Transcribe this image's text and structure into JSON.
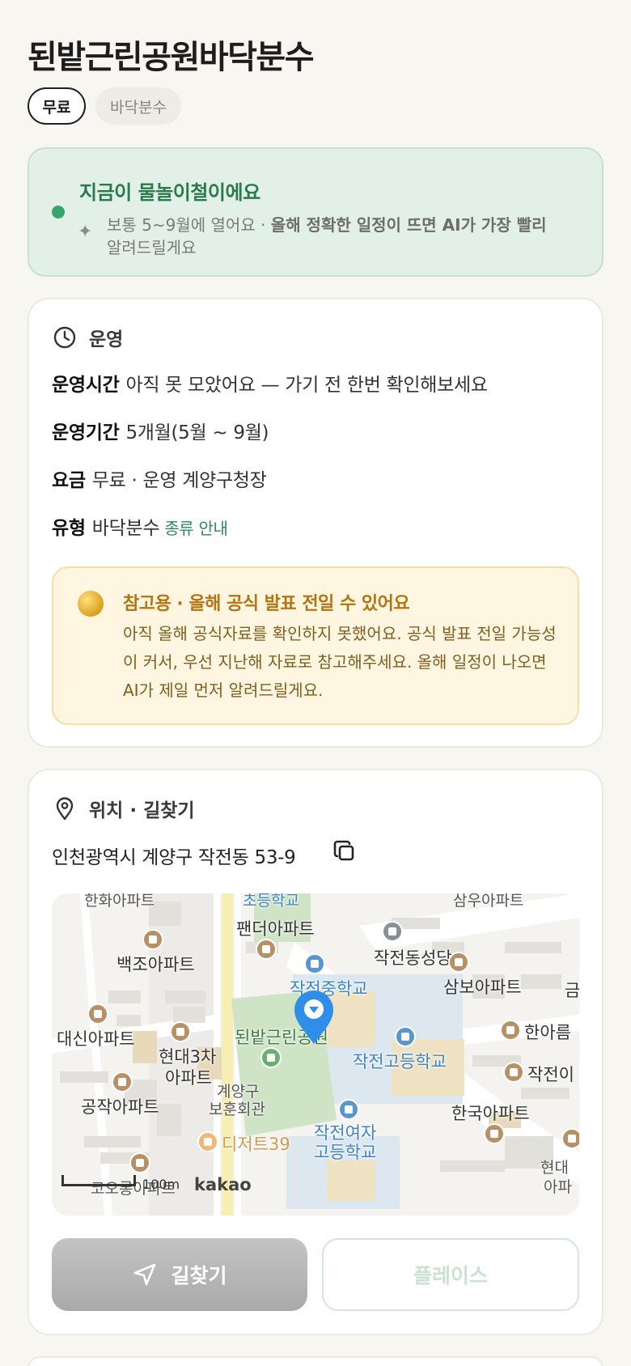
{
  "title": "된밭근린공원바닥분수",
  "chips": {
    "price": "무료",
    "type": "바닥분수"
  },
  "banner": {
    "headline": "지금이 물놀이철이에요",
    "sub_normal": "보통 5~9월에 열어요 · ",
    "sub_bold": "올해 정확한 일정이 뜨면 AI가 가장 빨리",
    "sub_tail": "알려드릴게요"
  },
  "operation": {
    "heading": "운영",
    "hours_key": "운영시간",
    "hours_val": "아직 못 모았어요 — 가기 전 한번 확인해보세요",
    "period_key": "운영기간",
    "period_val": "5개월(5월 ~ 9월)",
    "fee_key": "요금",
    "fee_val": "무료 · 운영 계양구청장",
    "type_key": "유형",
    "type_val": "바닥분수",
    "type_link": "종류 안내",
    "notice_title": "참고용 · 올해 공식 발표 전일 수 있어요",
    "notice_body": "아직 올해 공식자료를 확인하지 못했어요. 공식 발표 전일 가능성이 커서, 우선 지난해 자료로 참고해주세요. 올해 일정이 나오면 AI가 제일 먼저 알려드릴게요."
  },
  "location": {
    "heading": "위치 · 길찾기",
    "address": "인천광역시 계양구 작전동 53-9",
    "map": {
      "labels": {
        "top_left": "한화아파트",
        "top_school": "초등학교",
        "top_right": "삼우아파트",
        "pandeo": "팬더아파트",
        "baekjo": "백조아파트",
        "church": "작전동성당",
        "middle_school": "작전중학교",
        "sambo": "삼보아파트",
        "geum": "금",
        "daesin": "대신아파트",
        "hyundai3": "현대3차",
        "hyundai3b": "아파트",
        "park": "된밭근린공원",
        "hanareum": "한아름",
        "high_school": "작전고등학교",
        "jakjeon_right": "작전이",
        "gongjak": "공작아파트",
        "veterans1": "계양구",
        "veterans2": "보훈회관",
        "hanguk": "한국아파트",
        "girls_hs1": "작전여자",
        "girls_hs2": "고등학교",
        "cafe": "디저트39",
        "hyundai_r1": "현대",
        "hyundai_r2": "아파",
        "koorong": "코오롱아파트",
        "kakao": "kakao",
        "scale": "100m"
      }
    }
  },
  "buttons": {
    "directions": "길찾기",
    "place": "플레이스"
  }
}
